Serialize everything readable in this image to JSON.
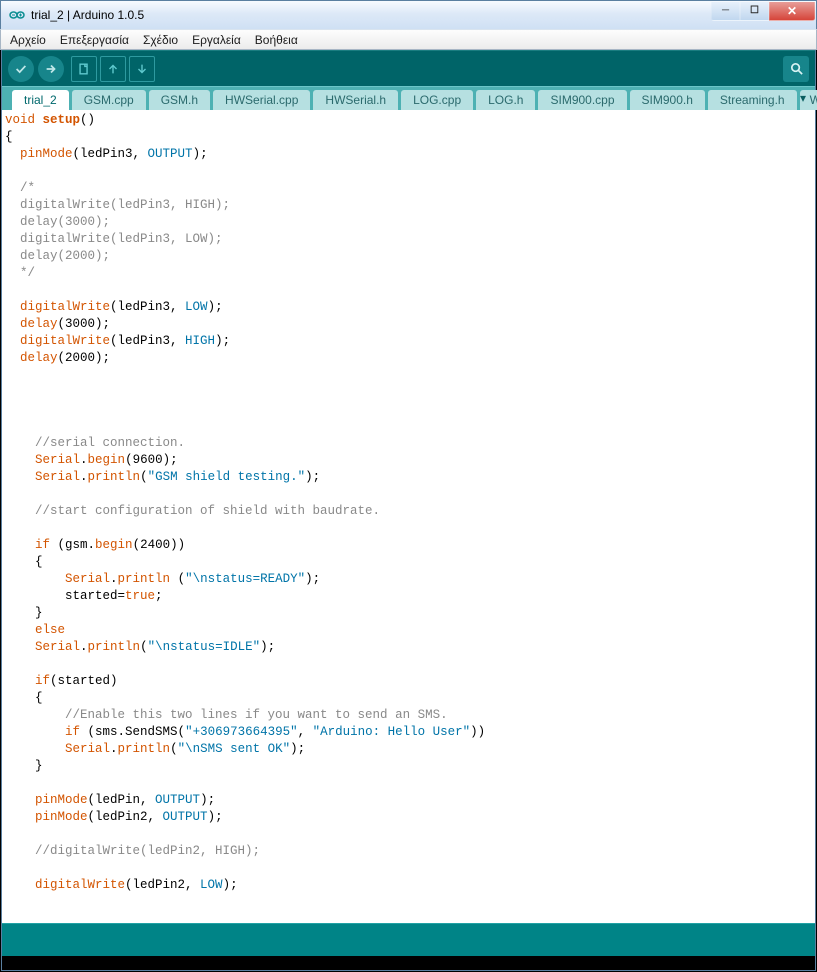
{
  "window": {
    "title": "trial_2 | Arduino 1.0.5"
  },
  "menu": {
    "file": "Αρχείο",
    "edit": "Επεξεργασία",
    "sketch": "Σχέδιο",
    "tools": "Εργαλεία",
    "help": "Βοήθεια"
  },
  "tabs": [
    "trial_2",
    "GSM.cpp",
    "GSM.h",
    "HWSerial.cpp",
    "HWSerial.h",
    "LOG.cpp",
    "LOG.h",
    "SIM900.cpp",
    "SIM900.h",
    "Streaming.h",
    "W"
  ],
  "code": {
    "l01a": "void",
    "l01b": " ",
    "l01c": "setup",
    "l01d": "()",
    "l02": "{",
    "l03a": "  ",
    "l03b": "pinMode",
    "l03c": "(ledPin3, ",
    "l03d": "OUTPUT",
    "l03e": ");",
    "l05": "  /*",
    "l06": "  digitalWrite(ledPin3, HIGH);",
    "l07": "  delay(3000);",
    "l08": "  digitalWrite(ledPin3, LOW);",
    "l09": "  delay(2000);",
    "l10": "  */",
    "l12a": "  ",
    "l12b": "digitalWrite",
    "l12c": "(ledPin3, ",
    "l12d": "LOW",
    "l12e": ");",
    "l13a": "  ",
    "l13b": "delay",
    "l13c": "(3000);",
    "l14a": "  ",
    "l14b": "digitalWrite",
    "l14c": "(ledPin3, ",
    "l14d": "HIGH",
    "l14e": ");",
    "l15a": "  ",
    "l15b": "delay",
    "l15c": "(2000);",
    "l21": "    //serial connection.",
    "l22a": "    ",
    "l22b": "Serial",
    "l22c": ".",
    "l22d": "begin",
    "l22e": "(9600);",
    "l23a": "    ",
    "l23b": "Serial",
    "l23c": ".",
    "l23d": "println",
    "l23e": "(",
    "l23f": "\"GSM shield testing.\"",
    "l23g": ");",
    "l25": "    //start configuration of shield with baudrate.",
    "l27a": "    ",
    "l27b": "if",
    "l27c": " (gsm.",
    "l27d": "begin",
    "l27e": "(2400))",
    "l28": "    {",
    "l29a": "        ",
    "l29b": "Serial",
    "l29c": ".",
    "l29d": "println",
    "l29e": " (",
    "l29f": "\"\\nstatus=READY\"",
    "l29g": ");",
    "l30a": "        started=",
    "l30b": "true",
    "l30c": ";",
    "l31": "    }",
    "l32a": "    ",
    "l32b": "else",
    "l33a": "    ",
    "l33b": "Serial",
    "l33c": ".",
    "l33d": "println",
    "l33e": "(",
    "l33f": "\"\\nstatus=IDLE\"",
    "l33g": ");",
    "l35a": "    ",
    "l35b": "if",
    "l35c": "(started)",
    "l36": "    {",
    "l37": "        //Enable this two lines if you want to send an SMS.",
    "l38a": "        ",
    "l38b": "if",
    "l38c": " (sms.SendSMS(",
    "l38d": "\"+306973664395\"",
    "l38e": ", ",
    "l38f": "\"Arduino: Hello User\"",
    "l38g": "))",
    "l39a": "        ",
    "l39b": "Serial",
    "l39c": ".",
    "l39d": "println",
    "l39e": "(",
    "l39f": "\"\\nSMS sent OK\"",
    "l39g": ");",
    "l40": "    }",
    "l42a": "    ",
    "l42b": "pinMode",
    "l42c": "(ledPin, ",
    "l42d": "OUTPUT",
    "l42e": ");",
    "l43a": "    ",
    "l43b": "pinMode",
    "l43c": "(ledPin2, ",
    "l43d": "OUTPUT",
    "l43e": ");",
    "l45": "    //digitalWrite(ledPin2, HIGH);",
    "l47a": "    ",
    "l47b": "digitalWrite",
    "l47c": "(ledPin2, ",
    "l47d": "LOW",
    "l47e": ");"
  }
}
